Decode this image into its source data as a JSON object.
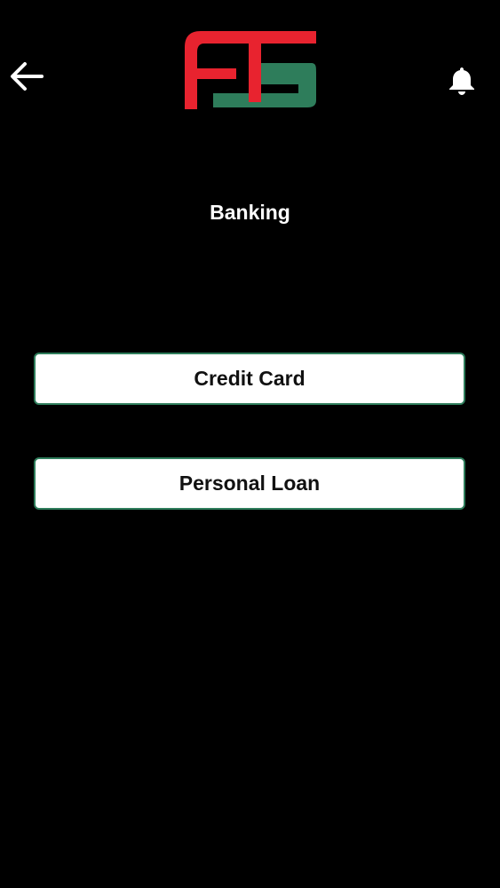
{
  "header": {
    "back_icon": "arrow-left-icon",
    "logo": {
      "text": "FTS",
      "colors": {
        "red": "#e8232f",
        "green": "#2e7d5b"
      }
    },
    "notification_icon": "bell-icon"
  },
  "main": {
    "title": "Banking",
    "options": [
      {
        "label": "Credit Card"
      },
      {
        "label": "Personal Loan"
      }
    ]
  },
  "colors": {
    "background": "#000000",
    "text": "#ffffff",
    "button_background": "#ffffff",
    "button_border": "#2e7d5b",
    "button_text": "#111111"
  }
}
